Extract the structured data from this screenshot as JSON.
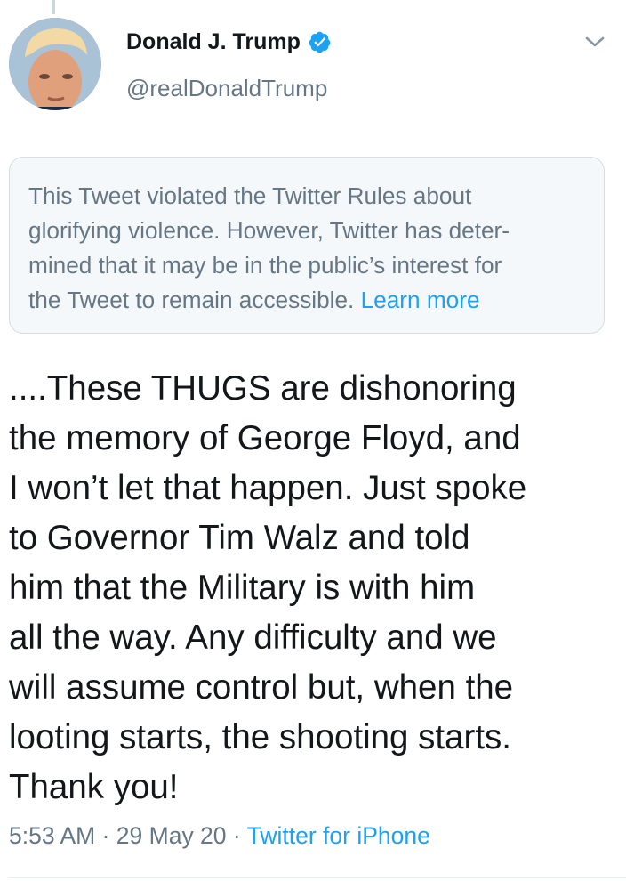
{
  "user": {
    "display_name": "Donald J. Trump",
    "handle": "@realDonaldTrump",
    "verified": true
  },
  "notice": {
    "lines": [
      "This Tweet violated the Twitter Rules about",
      "glorifying violence. However, Twitter has deter-",
      "mined that it may be in the public’s interest for",
      "the Tweet to remain accessible. "
    ],
    "link_label": "Learn more"
  },
  "tweet": {
    "text": "....These THUGS are dishonoring\nthe memory of George Floyd, and\nI won’t let that happen. Just spoke\nto Governor Tim Walz and told\nhim that the Military is with him\nall the way. Any difficulty and we\nwill assume control but, when the\nlooting starts, the shooting starts.\nThank you!"
  },
  "meta": {
    "time": "5:53 AM",
    "sep1": " · ",
    "date": "29 May 20",
    "sep2": " · ",
    "source": "Twitter for iPhone"
  },
  "colors": {
    "text": "#14171a",
    "secondary": "#657786",
    "accent": "#1da1f2",
    "notice_bg": "#f5f8fa",
    "notice_border": "#d6dee4"
  },
  "icons": {
    "verified": "verified-badge-icon",
    "menu": "chevron-down-icon"
  }
}
